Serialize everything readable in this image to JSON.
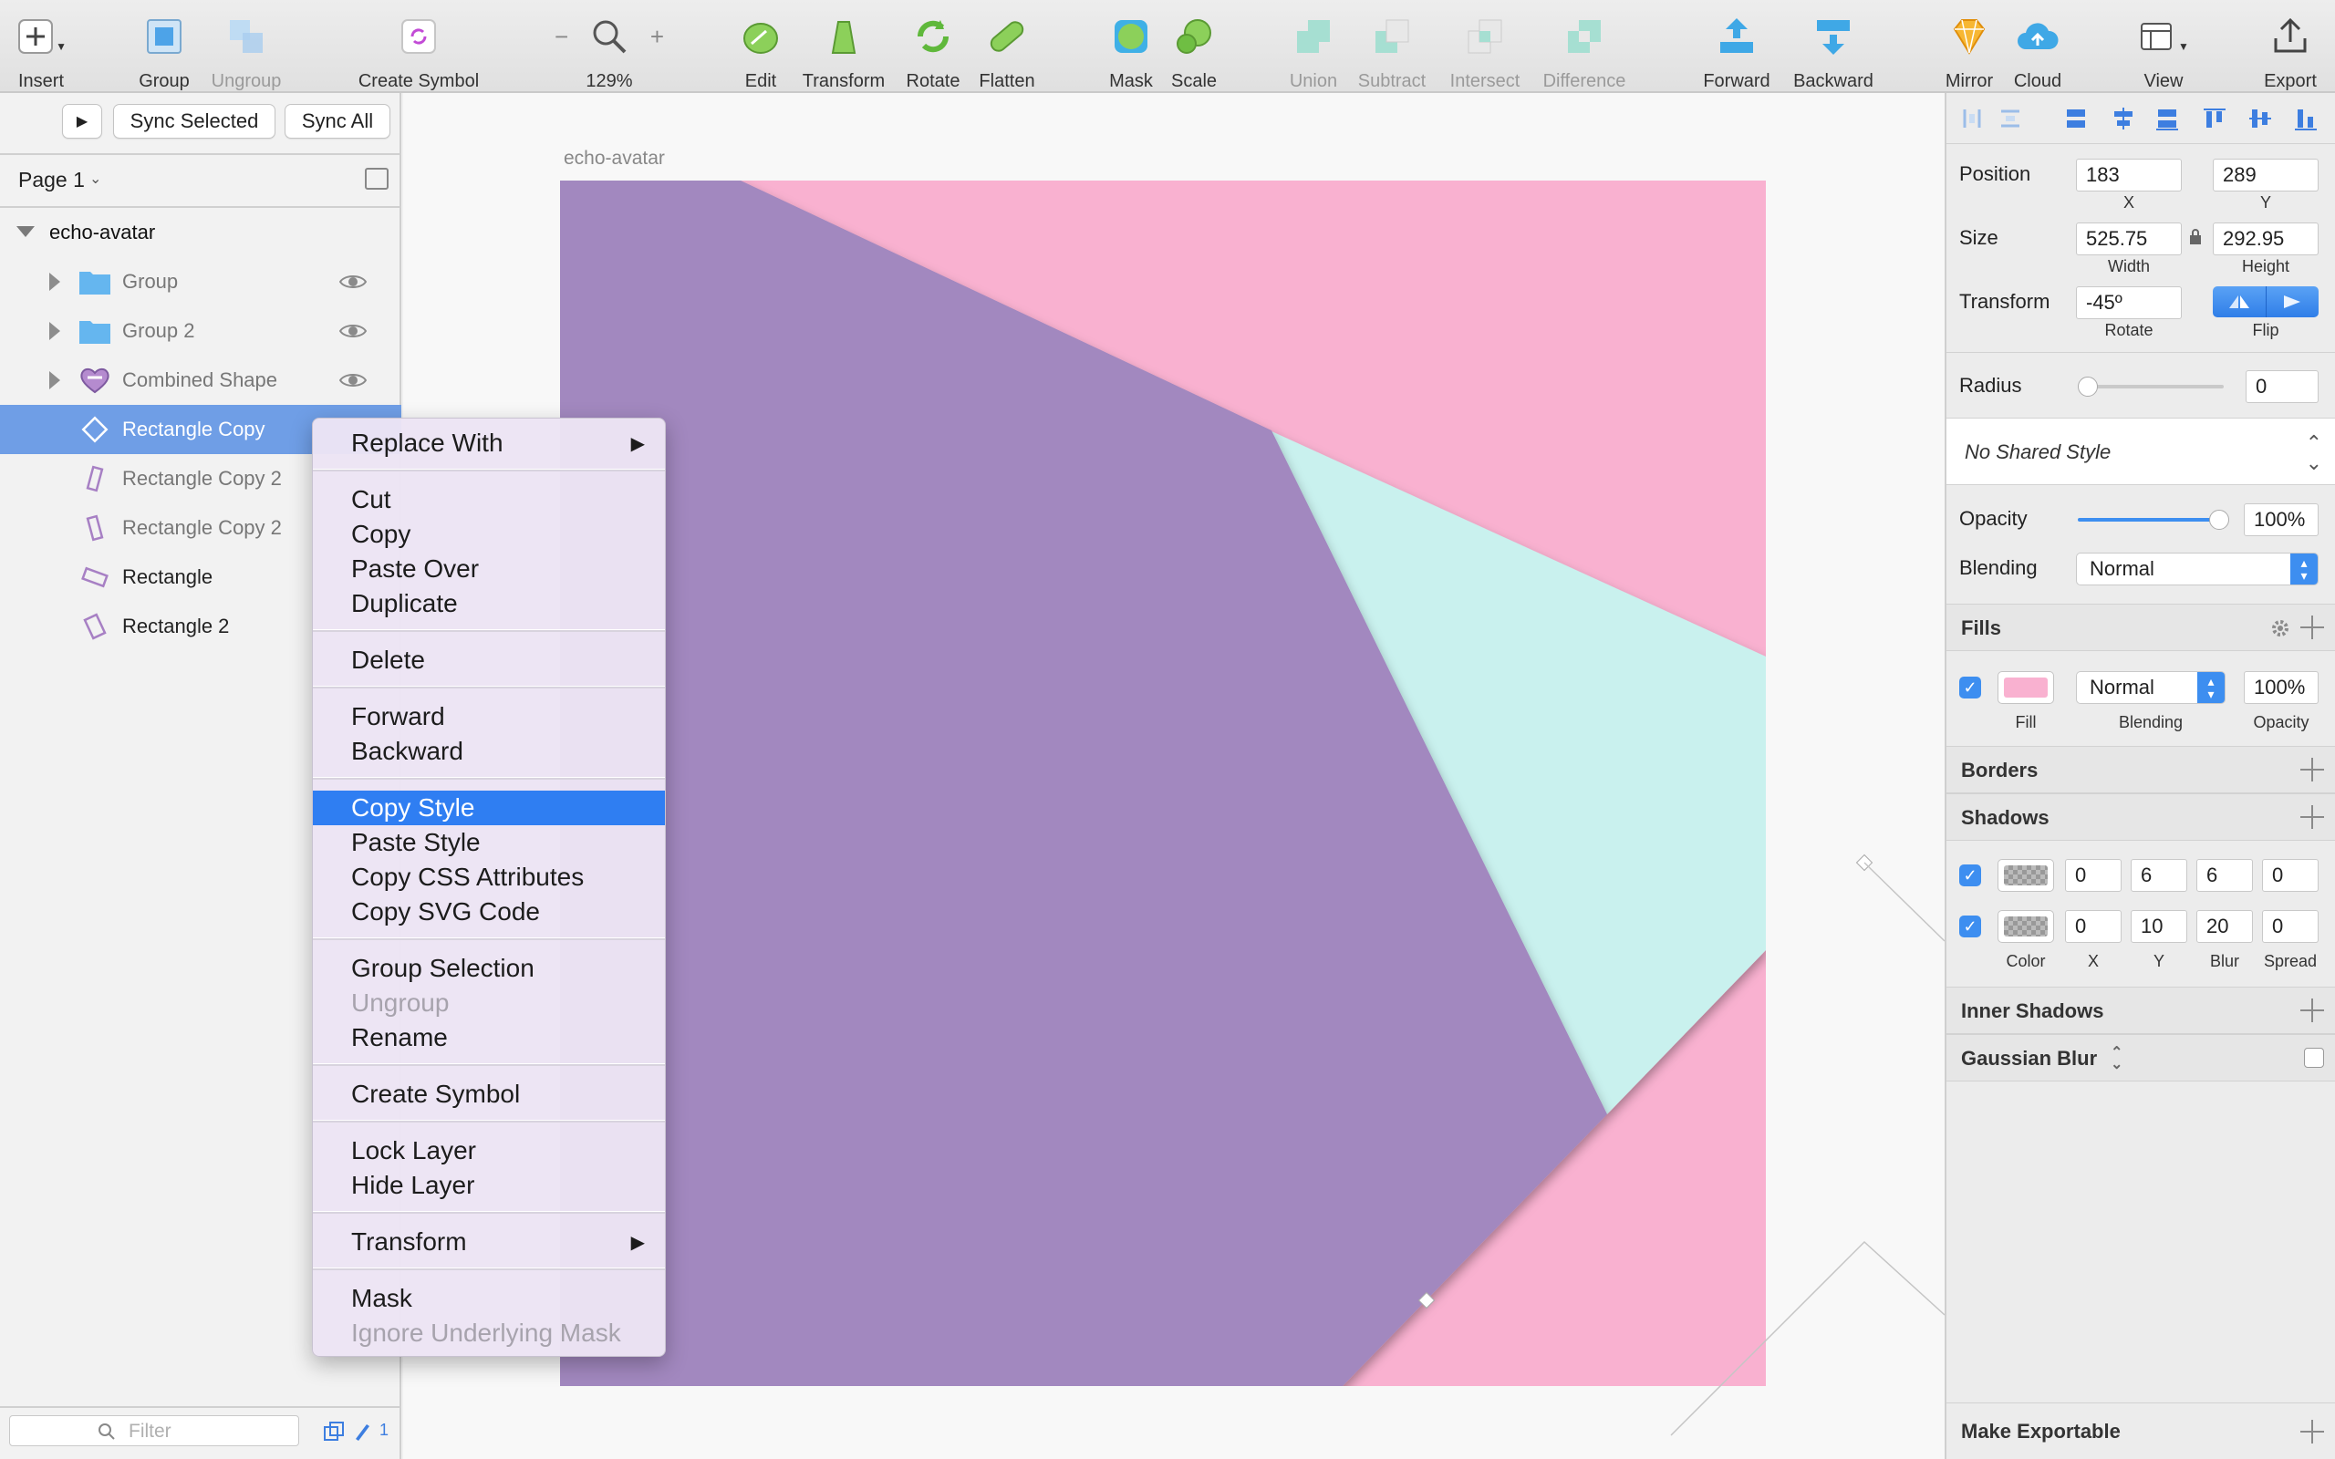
{
  "toolbar": {
    "insert": "Insert",
    "group": "Group",
    "ungroup": "Ungroup",
    "create_symbol": "Create Symbol",
    "zoom": "129%",
    "edit": "Edit",
    "transform": "Transform",
    "rotate": "Rotate",
    "flatten": "Flatten",
    "mask": "Mask",
    "scale": "Scale",
    "union": "Union",
    "subtract": "Subtract",
    "intersect": "Intersect",
    "difference": "Difference",
    "forward": "Forward",
    "backward": "Backward",
    "mirror": "Mirror",
    "cloud": "Cloud",
    "view": "View",
    "export": "Export"
  },
  "left_panel": {
    "sync_selected": "Sync Selected",
    "sync_all": "Sync All",
    "page": "Page 1",
    "artboard": "echo-avatar",
    "layers": [
      {
        "name": "Group"
      },
      {
        "name": "Group 2"
      },
      {
        "name": "Combined Shape"
      },
      {
        "name": "Rectangle Copy"
      },
      {
        "name": "Rectangle Copy 2"
      },
      {
        "name": "Rectangle Copy 2"
      },
      {
        "name": "Rectangle"
      },
      {
        "name": "Rectangle 2"
      }
    ],
    "filter_placeholder": "Filter",
    "edit_count": "1"
  },
  "canvas": {
    "artboard_title": "echo-avatar",
    "colors": {
      "background": "#f9b1d0",
      "purple": "#a288bf",
      "teal": "#c9f1ee"
    }
  },
  "context_menu": {
    "items": [
      {
        "label": "Replace With",
        "submenu": "▶"
      },
      {
        "label": "Cut"
      },
      {
        "label": "Copy"
      },
      {
        "label": "Paste Over"
      },
      {
        "label": "Duplicate"
      },
      {
        "label": "Delete"
      },
      {
        "label": "Forward"
      },
      {
        "label": "Backward"
      },
      {
        "label": "Copy Style"
      },
      {
        "label": "Paste Style"
      },
      {
        "label": "Copy CSS Attributes"
      },
      {
        "label": "Copy SVG Code"
      },
      {
        "label": "Group Selection"
      },
      {
        "label": "Ungroup"
      },
      {
        "label": "Rename"
      },
      {
        "label": "Create Symbol"
      },
      {
        "label": "Lock Layer"
      },
      {
        "label": "Hide Layer"
      },
      {
        "label": "Transform",
        "submenu": "▶"
      },
      {
        "label": "Mask"
      },
      {
        "label": "Ignore Underlying Mask"
      }
    ]
  },
  "inspector": {
    "position_label": "Position",
    "x": "183",
    "y": "289",
    "x_label": "X",
    "y_label": "Y",
    "size_label": "Size",
    "width": "525.75",
    "height": "292.95",
    "width_label": "Width",
    "height_label": "Height",
    "transform_label": "Transform",
    "rotate": "-45º",
    "rotate_label": "Rotate",
    "flip_label": "Flip",
    "radius_label": "Radius",
    "radius": "0",
    "shared_style": "No Shared Style",
    "opacity_label": "Opacity",
    "opacity": "100%",
    "blending_label": "Blending",
    "blending": "Normal",
    "fills_title": "Fills",
    "fill": {
      "color": "#f9b1d0",
      "blending": "Normal",
      "opacity": "100%",
      "fill_label": "Fill",
      "blending_label": "Blending",
      "opacity_label": "Opacity"
    },
    "borders_title": "Borders",
    "shadows_title": "Shadows",
    "shadows": [
      {
        "x": "0",
        "y": "6",
        "blur": "6",
        "spread": "0"
      },
      {
        "x": "0",
        "y": "10",
        "blur": "20",
        "spread": "0"
      }
    ],
    "shadow_labels": {
      "color": "Color",
      "x": "X",
      "y": "Y",
      "blur": "Blur",
      "spread": "Spread"
    },
    "inner_shadows_title": "Inner Shadows",
    "gaussian_blur_title": "Gaussian Blur",
    "make_exportable": "Make Exportable"
  }
}
